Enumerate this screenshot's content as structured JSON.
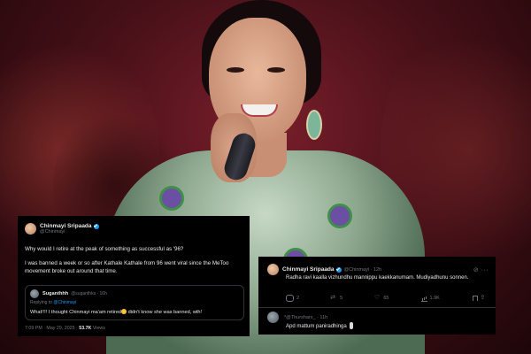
{
  "tweet_left": {
    "author_name": "Chinmayi Sripaada",
    "author_handle": "@Chinmayi",
    "text_line1": "Why would I retire at the peak of something as successful as '96?",
    "text_line2": "I was banned a week or so after Kathale Kathale from 96 went viral since the MeToo movement broke out around that time.",
    "quoted": {
      "author_name": "Suganthhh",
      "author_handle": "@suganthks · 16h",
      "replying_prefix": "Replying to ",
      "replying_to": "@Chinmayi",
      "text_before_emoji": "What!!!! I thought Chinmayi ma'am retired",
      "text_after_emoji": " didn't know she was banned, wth!"
    },
    "timestamp": "7:09 PM · May 29, 2025 · ",
    "views": "53.7K",
    "views_suffix": " Views"
  },
  "tweet_right": {
    "author_name": "Chinmayi Sripaada",
    "author_handle": "@Chinmayi · 12h",
    "text": "Radha ravi kaalla vizhundhu mannippu kaekkanumam. Mudiyadhunu sonnen.",
    "actions": {
      "replies": "2",
      "retweets": "5",
      "likes": "65",
      "views": "1.9K"
    },
    "reply": {
      "author_handle": "*@Thursharx_ · 11h",
      "text": "Apd mattum paniradhinga"
    }
  },
  "colors": {
    "card_bg": "#000000",
    "verified_blue": "#1d9bf0",
    "text_primary": "#e7e9ea",
    "text_secondary": "#71767b"
  }
}
